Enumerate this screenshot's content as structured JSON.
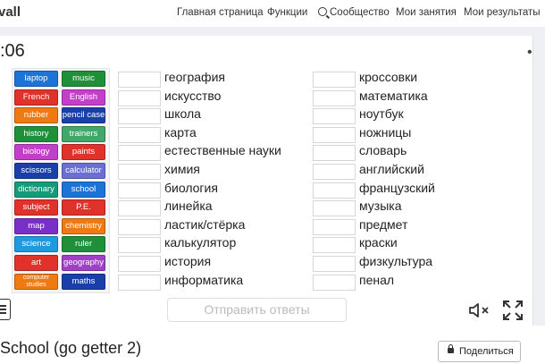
{
  "header": {
    "logo": "vall",
    "nav": [
      "Главная страница",
      "Функции",
      "Сообщество",
      "Мои занятия",
      "Мои результаты"
    ]
  },
  "activity": {
    "timer": ":06",
    "tiles": [
      {
        "label": "laptop",
        "color": "#1e73d6"
      },
      {
        "label": "music",
        "color": "#1f8f3a"
      },
      {
        "label": "French",
        "color": "#e0322b"
      },
      {
        "label": "English",
        "color": "#c23fc9"
      },
      {
        "label": "rubber",
        "color": "#f07a12"
      },
      {
        "label": "pencil case",
        "color": "#1a3fa8"
      },
      {
        "label": "history",
        "color": "#1f8f3a"
      },
      {
        "label": "trainers",
        "color": "#43a66a"
      },
      {
        "label": "biology",
        "color": "#c23fc9"
      },
      {
        "label": "paints",
        "color": "#e0322b"
      },
      {
        "label": "scissors",
        "color": "#1a3fa8"
      },
      {
        "label": "calculator",
        "color": "#6a6fd6"
      },
      {
        "label": "dictionary",
        "color": "#159a7a"
      },
      {
        "label": "school",
        "color": "#1e73d6"
      },
      {
        "label": "subject",
        "color": "#e0322b"
      },
      {
        "label": "P.E.",
        "color": "#e0322b"
      },
      {
        "label": "map",
        "color": "#7a2fc9"
      },
      {
        "label": "chemistry",
        "color": "#f07a12"
      },
      {
        "label": "science",
        "color": "#1e9ae0"
      },
      {
        "label": "ruler",
        "color": "#1f8f3a"
      },
      {
        "label": "art",
        "color": "#e0322b"
      },
      {
        "label": "geography",
        "color": "#a23fc9"
      },
      {
        "label": "computer studies",
        "color": "#f07a12"
      },
      {
        "label": "maths",
        "color": "#1a3fa8"
      }
    ],
    "words_left": [
      "география",
      "искусство",
      "школа",
      "карта",
      "естественные науки",
      "химия",
      "биология",
      "линейка",
      "ластик/стёрка",
      "калькулятор",
      "история",
      "информатика"
    ],
    "words_right": [
      "кроссовки",
      "математика",
      "ноутбук",
      "ножницы",
      "словарь",
      "английский",
      "французский",
      "музыка",
      "предмет",
      "краски",
      "физкультура",
      "пенал"
    ],
    "submit_label": "Отправить ответы"
  },
  "footer": {
    "title": "School (go getter 2)",
    "share_label": "Поделиться"
  }
}
